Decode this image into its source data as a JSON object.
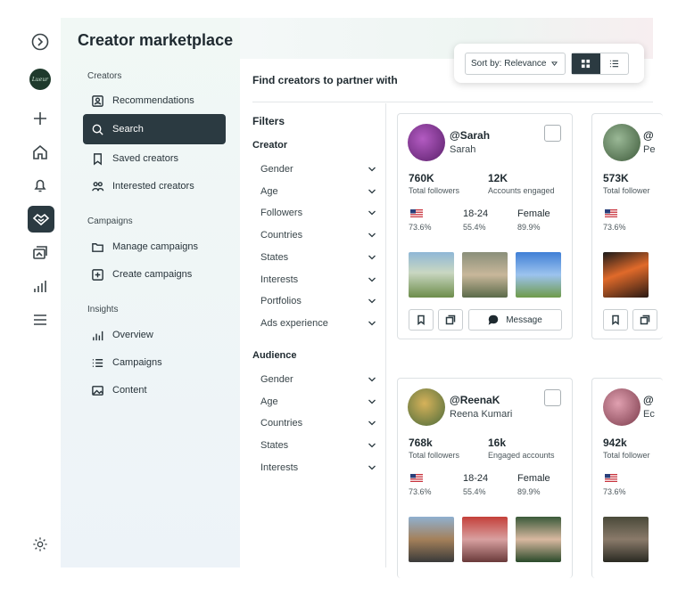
{
  "app": {
    "title": "Creator marketplace"
  },
  "sidebar": {
    "sections": [
      {
        "label": "Creators",
        "items": [
          {
            "label": "Recommendations",
            "icon": "recommendations-icon"
          },
          {
            "label": "Search",
            "icon": "search-icon",
            "active": true
          },
          {
            "label": "Saved creators",
            "icon": "bookmark-icon"
          },
          {
            "label": "Interested creators",
            "icon": "people-icon"
          }
        ]
      },
      {
        "label": "Campaigns",
        "items": [
          {
            "label": "Manage campaigns",
            "icon": "folder-icon"
          },
          {
            "label": "Create campaigns",
            "icon": "plus-square-icon"
          }
        ]
      },
      {
        "label": "Insights",
        "items": [
          {
            "label": "Overview",
            "icon": "bar-chart-icon"
          },
          {
            "label": "Campaigns",
            "icon": "list-icon"
          },
          {
            "label": "Content",
            "icon": "image-icon"
          }
        ]
      }
    ]
  },
  "rail": {
    "logo_text": "Lueur",
    "icons": [
      "collapse-icon",
      "brand-logo",
      "plus-icon",
      "home-icon",
      "bell-icon",
      "handshake-icon",
      "gallery-icon",
      "analytics-icon",
      "menu-icon",
      "settings-icon"
    ]
  },
  "main": {
    "heading": "Find creators to partner with",
    "sort_label": "Sort by: Relevance"
  },
  "filters": {
    "title": "Filters",
    "groups": [
      {
        "title": "Creator",
        "items": [
          "Gender",
          "Age",
          "Followers",
          "Countries",
          "States",
          "Interests",
          "Portfolios",
          "Ads experience"
        ]
      },
      {
        "title": "Audience",
        "items": [
          "Gender",
          "Age",
          "Countries",
          "States",
          "Interests"
        ]
      }
    ]
  },
  "cards": [
    {
      "handle": "@Sarah",
      "name": "Sarah",
      "followers": "760K",
      "followers_label": "Total followers",
      "engaged": "12K",
      "engaged_label": "Accounts engaged",
      "country_pct": "73.6%",
      "age": "18-24",
      "age_pct": "55.4%",
      "gender": "Female",
      "gender_pct": "89.9%",
      "message_label": "Message",
      "avatar_color": "#7a3a8a"
    },
    {
      "handle": "@",
      "name": "Pe",
      "followers": "573K",
      "followers_label": "Total follower",
      "country_pct": "73.6%",
      "avatar_color": "#4e6b4a"
    },
    {
      "handle": "@ReenaK",
      "name": "Reena Kumari",
      "followers": "768k",
      "followers_label": "Total followers",
      "engaged": "16k",
      "engaged_label": "Engaged accounts",
      "country_pct": "73.6%",
      "age": "18-24",
      "age_pct": "55.4%",
      "gender": "Female",
      "gender_pct": "89.9%",
      "avatar_color": "#8a6a3a"
    },
    {
      "handle": "@",
      "name": "Ec",
      "followers": "942k",
      "followers_label": "Total follower",
      "country_pct": "73.6%",
      "avatar_color": "#9a5060"
    }
  ],
  "colors": {
    "accent_dark": "#2b3a41",
    "panel_bg": "#f1f8f5"
  }
}
